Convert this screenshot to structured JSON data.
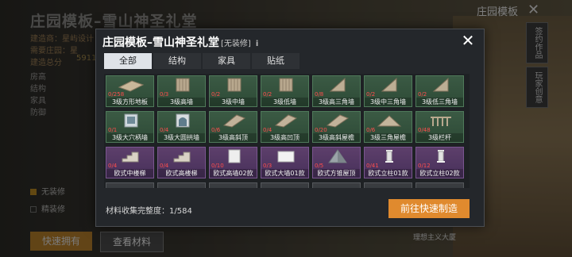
{
  "background": {
    "title": "庄园模板–雪山神圣礼堂",
    "top_right_label": "庄园模板",
    "close_glyph": "✕",
    "info_lines": [
      "建造商：星屿设计",
      "需要庄园：星",
      "建造总分"
    ],
    "score_value": "5911",
    "sidebar_labels": [
      "房高",
      "结构",
      "家具",
      "防御"
    ],
    "checks": [
      "无装修",
      "精装修"
    ],
    "btn_quick": "快速拥有",
    "btn_view": "查看材料",
    "right_tabs": [
      "签约作品",
      "玩家创意"
    ],
    "bottom_label": "理想主义大厦"
  },
  "modal": {
    "title": "庄园模板–雪山神圣礼堂",
    "tag": "[无装修]",
    "info_glyph": "i",
    "close_glyph": "✕",
    "tabs": [
      {
        "label": "全部",
        "active": true
      },
      {
        "label": "结构",
        "active": false
      },
      {
        "label": "家具",
        "active": false
      },
      {
        "label": "贴纸",
        "active": false
      }
    ],
    "items": [
      {
        "count": "0/258",
        "name": "3级方形地板",
        "color": "green",
        "icon": "floor-icon"
      },
      {
        "count": "0/3",
        "name": "3级高墙",
        "color": "green",
        "icon": "wall-icon"
      },
      {
        "count": "0/2",
        "name": "3级中墙",
        "color": "green",
        "icon": "wall-icon"
      },
      {
        "count": "0/2",
        "name": "3级低墙",
        "color": "green",
        "icon": "wall-icon"
      },
      {
        "count": "0/8",
        "name": "3级高三角墙",
        "color": "green",
        "icon": "triangle-wall-icon"
      },
      {
        "count": "0/2",
        "name": "3级中三角墙",
        "color": "green",
        "icon": "triangle-wall-icon"
      },
      {
        "count": "0/2",
        "name": "3级低三角墙",
        "color": "green",
        "icon": "triangle-wall-icon"
      },
      {
        "count": "0/1",
        "name": "3级大穴柄墙",
        "color": "green",
        "icon": "window-wall-icon"
      },
      {
        "count": "0/4",
        "name": "3级大圆拱墙",
        "color": "green",
        "icon": "arch-window-icon"
      },
      {
        "count": "0/6",
        "name": "3级高斜顶",
        "color": "green",
        "icon": "roof-icon"
      },
      {
        "count": "0/4",
        "name": "3级高凹顶",
        "color": "green",
        "icon": "roof-icon"
      },
      {
        "count": "0/20",
        "name": "3级高斜屋檐",
        "color": "green",
        "icon": "roof-icon"
      },
      {
        "count": "0/6",
        "name": "3级三角屋檐",
        "color": "green",
        "icon": "gable-roof-icon"
      },
      {
        "count": "0/48",
        "name": "3级栏杆",
        "color": "green",
        "icon": "railing-icon"
      },
      {
        "count": "0/4",
        "name": "欧式中楼梯",
        "color": "purple",
        "icon": "stairs-icon"
      },
      {
        "count": "0/4",
        "name": "欧式高楼梯",
        "color": "purple",
        "icon": "stairs-icon"
      },
      {
        "count": "0/10",
        "name": "欧式高墙02款",
        "color": "purple",
        "icon": "white-wall-icon"
      },
      {
        "count": "0/3",
        "name": "欧式大墙01款",
        "color": "purple",
        "icon": "white-panel-icon"
      },
      {
        "count": "0/5",
        "name": "欧式方锥屋顶",
        "color": "purple",
        "icon": "pyramid-roof-icon"
      },
      {
        "count": "0/41",
        "name": "欧式立柱01款",
        "color": "purple",
        "icon": "column-icon"
      },
      {
        "count": "0/12",
        "name": "欧式立柱02款",
        "color": "purple",
        "icon": "column-icon"
      },
      {
        "count": "",
        "name": "",
        "color": "dark",
        "icon": "partial-item-icon"
      },
      {
        "count": "",
        "name": "",
        "color": "dark",
        "icon": "partial-item-icon"
      },
      {
        "count": "",
        "name": "",
        "color": "dark",
        "icon": "partial-item-icon"
      },
      {
        "count": "",
        "name": "",
        "color": "dark",
        "icon": "partial-item-icon"
      },
      {
        "count": "",
        "name": "",
        "color": "dark",
        "icon": "partial-item-icon"
      },
      {
        "count": "",
        "name": "",
        "color": "dark",
        "icon": "partial-item-icon"
      },
      {
        "count": "",
        "name": "",
        "color": "dark",
        "icon": "partial-item-icon"
      }
    ],
    "completeness_label": "材料收集完整度：",
    "completeness_value": "1/584",
    "go_button": "前往快速制造",
    "colors": {
      "accent": "#e08a2e",
      "green_cell": "#3b5a44",
      "purple_cell": "#5d3f6b",
      "count_red": "#ff4d4d"
    }
  }
}
